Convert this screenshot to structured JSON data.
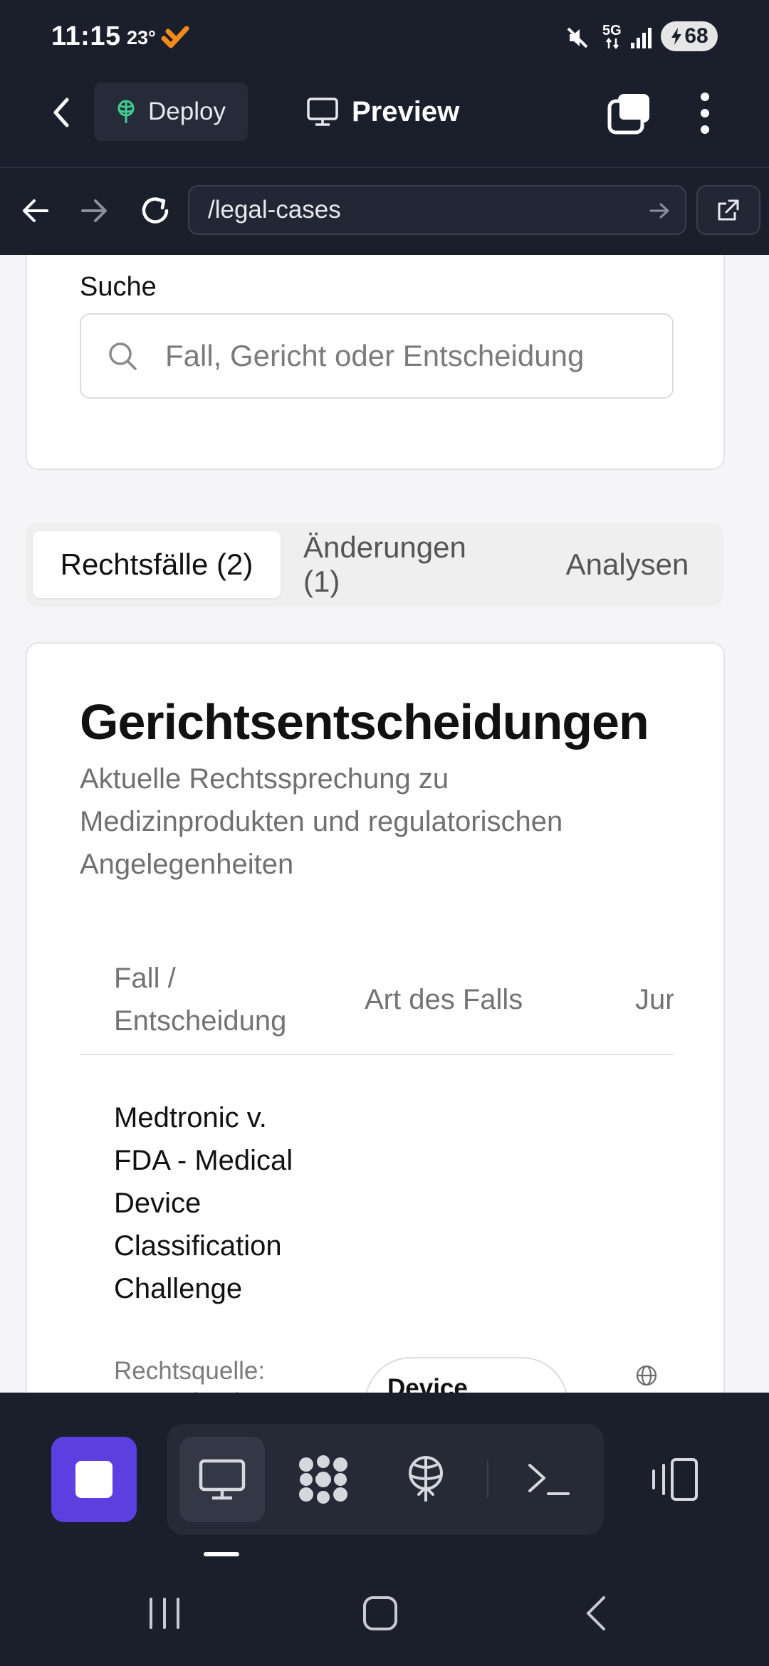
{
  "status_bar": {
    "time": "11:15",
    "temperature": "23°",
    "network": "5G",
    "battery": "68"
  },
  "app_header": {
    "deploy_label": "Deploy",
    "preview_label": "Preview"
  },
  "browser": {
    "url": "/legal-cases"
  },
  "search": {
    "label": "Suche",
    "placeholder": "Fall, Gericht oder Entscheidung"
  },
  "tabs": [
    {
      "label": "Rechtsfälle (2)",
      "active": true
    },
    {
      "label": "Änderungen (1)",
      "active": false
    },
    {
      "label": "Analysen",
      "active": false
    }
  ],
  "section": {
    "title": "Gerichtsentscheidungen",
    "description": "Aktuelle Rechtssprechung zu Medizinprodukten und regulatorischen Angelegenheiten"
  },
  "table": {
    "columns": [
      "Fall / Entscheidung",
      "Art des Falls",
      "Jurisdiktion"
    ],
    "rows": [
      {
        "case": "Medtronic v. FDA - Medical Device Classification Challenge",
        "source": "Rechtsquelle: US Federal",
        "type": "Device Classification"
      }
    ]
  },
  "colors": {
    "dark_bg": "#1b1f2c",
    "accent_purple": "#5b3fe0",
    "deploy_icon_green": "#3ecf8e",
    "battery_bolt": "#1b1f2c"
  },
  "icons": {
    "toolbar": [
      "stop-icon",
      "monitor-icon",
      "puzzle-icon",
      "deploy-icon",
      "terminal-icon",
      "device-toggle-icon"
    ]
  }
}
